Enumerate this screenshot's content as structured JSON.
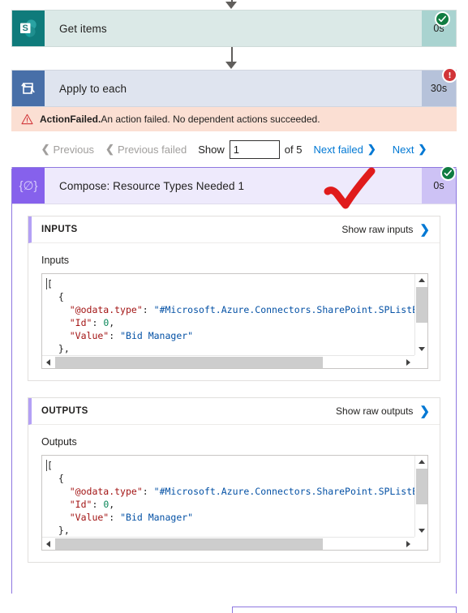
{
  "flow": {
    "actions": [
      {
        "id": "get-items",
        "title": "Get items",
        "duration": "0s",
        "status": "succeeded",
        "icon": "sharepoint-icon"
      },
      {
        "id": "apply-to-each",
        "title": "Apply to each",
        "duration": "30s",
        "status": "failed",
        "icon": "loop-icon"
      },
      {
        "id": "compose",
        "title": "Compose: Resource Types Needed 1",
        "duration": "0s",
        "status": "succeeded",
        "icon": "compose-icon"
      }
    ]
  },
  "error_banner": {
    "icon": "warning-icon",
    "code": "ActionFailed.",
    "message": " An action failed. No dependent actions succeeded."
  },
  "pager": {
    "previous": "Previous",
    "previous_failed": "Previous failed",
    "show_label": "Show",
    "current_value": "1",
    "current_placeholder": "",
    "of_label": "of 5",
    "next_failed": "Next failed",
    "next": "Next",
    "chevron_left": "❮",
    "chevron_right": "❯"
  },
  "inputs_panel": {
    "header": "INPUTS",
    "raw_link": "Show raw inputs",
    "section_label": "Inputs",
    "code_lines": [
      "[",
      "  {",
      "    \"@odata.type\": \"#Microsoft.Azure.Connectors.SharePoint.SPListE",
      "    \"Id\": 0,",
      "    \"Value\": \"Bid Manager\"",
      "  },",
      "  {"
    ]
  },
  "outputs_panel": {
    "header": "OUTPUTS",
    "raw_link": "Show raw outputs",
    "section_label": "Outputs",
    "code_lines": [
      "[",
      "  {",
      "    \"@odata.type\": \"#Microsoft.Azure.Connectors.SharePoint.SPListE",
      "    \"Id\": 0,",
      "    \"Value\": \"Bid Manager\"",
      "  },",
      "  {"
    ]
  },
  "annotation": {
    "shape": "red-checkmark",
    "color": "#e01b1b"
  },
  "colors": {
    "success": "#107c41",
    "error": "#d13438",
    "link": "#0078d4",
    "error_banner_bg": "#fbdfd3",
    "sharepoint_card_bg": "#dbe9e7",
    "loop_card_bg": "#dfe4ef",
    "compose_card_bg": "#eeeafc",
    "compose_accent": "#8661ec"
  }
}
